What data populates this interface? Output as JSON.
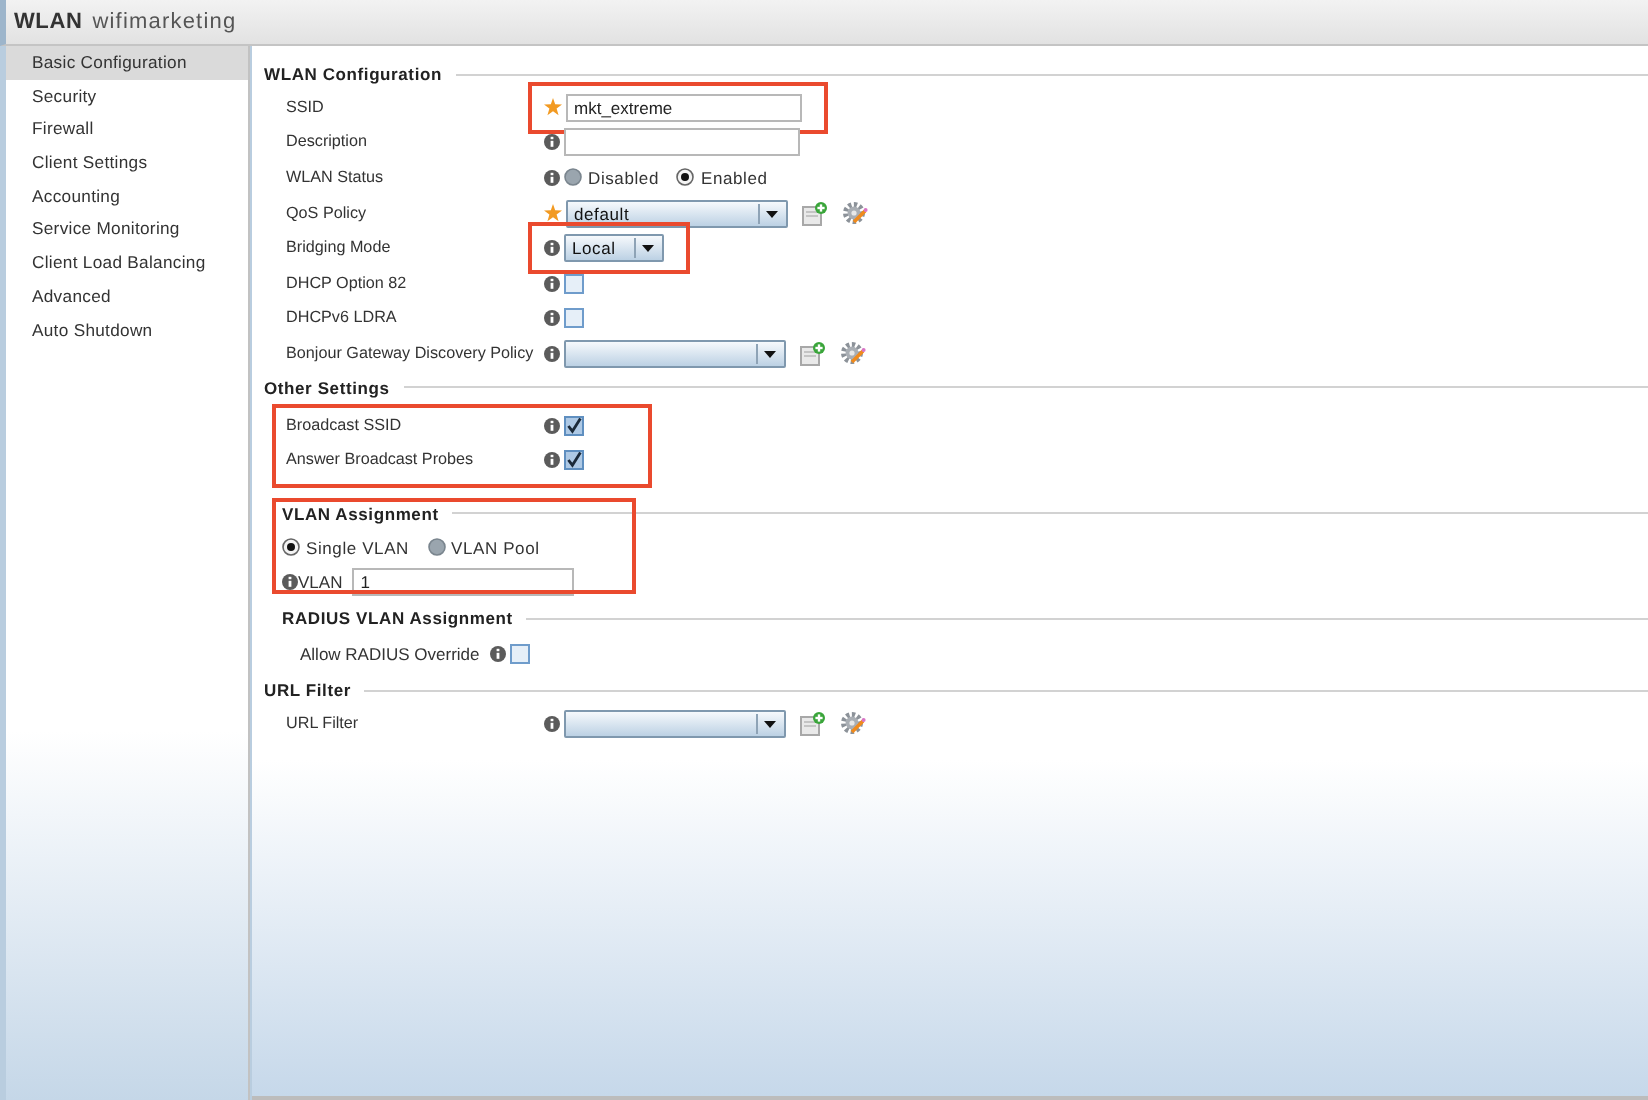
{
  "window": {
    "title": "WLAN",
    "subtitle": "wifimarketing"
  },
  "sidebar": {
    "items": [
      {
        "label": "Basic Configuration",
        "selected": true
      },
      {
        "label": "Security",
        "selected": false
      },
      {
        "label": "Firewall",
        "selected": false
      },
      {
        "label": "Client Settings",
        "selected": false
      },
      {
        "label": "Accounting",
        "selected": false
      },
      {
        "label": "Service Monitoring",
        "selected": false
      },
      {
        "label": "Client Load Balancing",
        "selected": false
      },
      {
        "label": "Advanced",
        "selected": false
      },
      {
        "label": "Auto Shutdown",
        "selected": false
      }
    ]
  },
  "sections": [
    {
      "title": "WLAN Configuration",
      "rows": [
        {
          "kind": "text",
          "label": "SSID",
          "required": true,
          "value": "mkt_extreme",
          "highlighted": true
        },
        {
          "kind": "text",
          "label": "Description",
          "required": false
        },
        {
          "kind": "radio",
          "label": "WLAN Status",
          "required": false,
          "options": [
            {
              "label": "Disabled",
              "selected": false
            },
            {
              "label": "Enabled",
              "selected": true
            }
          ]
        },
        {
          "kind": "select",
          "label": "QoS Policy",
          "required": true,
          "value": "default",
          "tools": true
        },
        {
          "kind": "select",
          "label": "Bridging Mode",
          "required": false,
          "value": "Local",
          "highlighted": true
        },
        {
          "kind": "checkbox",
          "label": "DHCP Option 82",
          "required": false,
          "checked": false
        },
        {
          "kind": "checkbox",
          "label": "DHCPv6 LDRA",
          "required": false,
          "checked": false
        },
        {
          "kind": "select",
          "label": "Bonjour Gateway Discovery Policy",
          "required": false,
          "tools": true
        }
      ]
    },
    {
      "title": "Other Settings",
      "rows_highlighted": true,
      "rows": [
        {
          "kind": "checkbox",
          "label": "Broadcast SSID",
          "required": false,
          "checked": true
        },
        {
          "kind": "checkbox",
          "label": "Answer Broadcast Probes",
          "required": false,
          "checked": true
        }
      ],
      "children": [
        {
          "title": "VLAN Assignment",
          "highlighted": true,
          "rows": [
            {
              "kind": "radio",
              "options": [
                {
                  "label": "Single VLAN",
                  "selected": true
                },
                {
                  "label": "VLAN Pool",
                  "selected": false
                }
              ]
            },
            {
              "kind": "inline-text",
              "label": "VLAN",
              "required": false,
              "value": "1"
            }
          ]
        },
        {
          "title": "RADIUS VLAN Assignment",
          "rows": [
            {
              "kind": "inline-checkbox",
              "label": "Allow RADIUS Override",
              "required": false,
              "checked": false
            }
          ]
        }
      ]
    },
    {
      "title": "URL Filter",
      "rows": [
        {
          "kind": "select",
          "label": "URL Filter",
          "required": false,
          "tools": true
        }
      ]
    }
  ]
}
